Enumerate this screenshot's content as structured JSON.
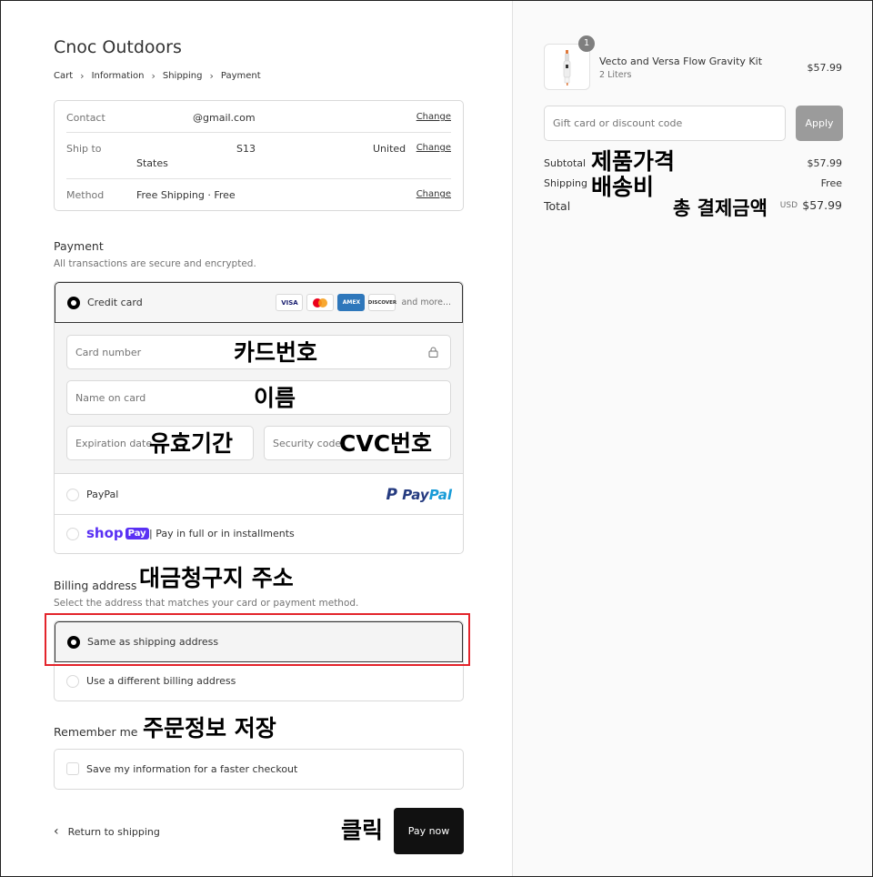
{
  "store": {
    "name": "Cnoc Outdoors"
  },
  "breadcrumb": [
    "Cart",
    "Information",
    "Shipping",
    "Payment"
  ],
  "review": {
    "contact_label": "Contact",
    "contact_value": "@gmail.com",
    "shipto_label": "Ship to",
    "shipto_value1": "S13",
    "shipto_value2": "United",
    "shipto_value3": "States",
    "method_label": "Method",
    "method_value": "Free Shipping · Free",
    "change": "Change"
  },
  "payment": {
    "title": "Payment",
    "subtitle": "All transactions are secure and encrypted.",
    "credit_card_label": "Credit card",
    "card_brands": [
      "VISA",
      "AMEX",
      "DISCOVER"
    ],
    "and_more": "and more...",
    "card_number_placeholder": "Card number",
    "name_placeholder": "Name on card",
    "expiration_placeholder": "Expiration date",
    "security_placeholder": "Security code",
    "paypal_label": "PayPal",
    "paypal_logo_a": "Pay",
    "paypal_logo_b": "Pal",
    "shop_logo": "shop",
    "shop_badge": "Pay",
    "shop_text": "| Pay in full or in installments"
  },
  "billing": {
    "title": "Billing address",
    "subtitle": "Select the address that matches your card or payment method.",
    "same_label": "Same as shipping address",
    "different_label": "Use a different billing address"
  },
  "remember": {
    "title": "Remember me",
    "save_label": "Save my information for a faster checkout"
  },
  "footer": {
    "return_label": "Return to shipping",
    "pay_label": "Pay now"
  },
  "annotations": {
    "card_number": "카드번호",
    "name": "이름",
    "expiration": "유효기간",
    "cvc": "CVC번호",
    "billing": "대금청구지 주소",
    "remember": "주문정보 저장",
    "click": "클릭",
    "product_price": "제품가격",
    "shipping_fee": "배송비",
    "total_amount": "총 결제금액"
  },
  "summary": {
    "quantity": "1",
    "product_name": "Vecto and Versa Flow Gravity Kit",
    "product_variant": "2 Liters",
    "product_price": "$57.99",
    "discount_placeholder": "Gift card or discount code",
    "apply_label": "Apply",
    "subtotal_label": "Subtotal",
    "subtotal_value": "$57.99",
    "shipping_label": "Shipping",
    "shipping_value": "Free",
    "total_label": "Total",
    "currency": "USD",
    "total_value": "$57.99"
  },
  "colors": {
    "highlight_frame": "#e3242b",
    "pay_button": "#111111",
    "apply_button": "#9b9b9b",
    "shop_purple": "#5a31f4",
    "paypal_dark": "#253b80",
    "paypal_light": "#179bd7"
  }
}
